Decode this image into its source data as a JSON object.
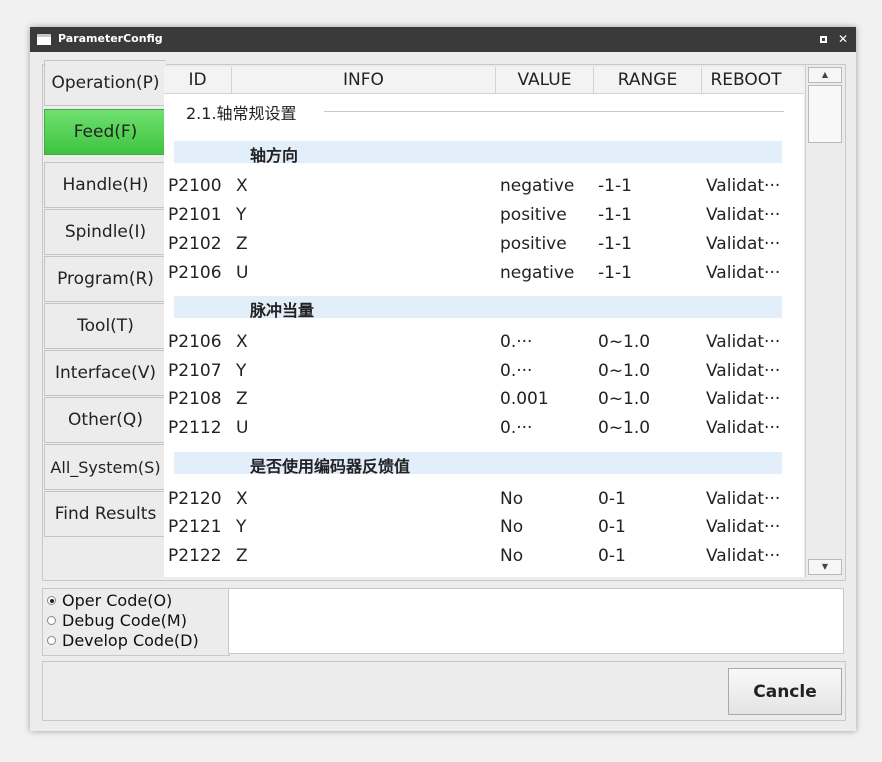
{
  "window": {
    "title": "ParameterConfig"
  },
  "sidebar": {
    "tabs": [
      {
        "label": "Operation(P)"
      },
      {
        "label": "Feed(F)",
        "active": true
      },
      {
        "label": "Handle(H)"
      },
      {
        "label": "Spindle(I)"
      },
      {
        "label": "Program(R)"
      },
      {
        "label": "Tool(T)"
      },
      {
        "label": "Interface(V)"
      },
      {
        "label": "Other(Q)"
      },
      {
        "label": "All_System(S)"
      },
      {
        "label": "Find Results"
      }
    ]
  },
  "table": {
    "headers": [
      "ID",
      "INFO",
      "VALUE",
      "RANGE",
      "REBOOT"
    ],
    "section_title": "2.1.轴常规设置",
    "groups": [
      {
        "name": "轴方向",
        "rows": [
          {
            "id": "P2100",
            "info": "X",
            "value": "negative",
            "range": "-1-1",
            "reboot": "Validat···"
          },
          {
            "id": "P2101",
            "info": "Y",
            "value": "positive",
            "range": "-1-1",
            "reboot": "Validat···"
          },
          {
            "id": "P2102",
            "info": "Z",
            "value": "positive",
            "range": "-1-1",
            "reboot": "Validat···"
          },
          {
            "id": "P2106",
            "info": "U",
            "value": "negative",
            "range": "-1-1",
            "reboot": "Validat···"
          }
        ]
      },
      {
        "name": "脉冲当量",
        "rows": [
          {
            "id": "P2106",
            "info": "X",
            "value": "0.···",
            "range": "0~1.0",
            "reboot": "Validat···"
          },
          {
            "id": "P2107",
            "info": "Y",
            "value": "0.···",
            "range": "0~1.0",
            "reboot": "Validat···"
          },
          {
            "id": "P2108",
            "info": "Z",
            "value": "0.001",
            "range": "0~1.0",
            "reboot": "Validat···"
          },
          {
            "id": "P2112",
            "info": "U",
            "value": "0.···",
            "range": "0~1.0",
            "reboot": "Validat···"
          }
        ]
      },
      {
        "name": "是否使用编码器反馈值",
        "rows": [
          {
            "id": "P2120",
            "info": "X",
            "value": "No",
            "range": "0-1",
            "reboot": "Validat···"
          },
          {
            "id": "P2121",
            "info": "Y",
            "value": "No",
            "range": "0-1",
            "reboot": "Validat···"
          },
          {
            "id": "P2122",
            "info": "Z",
            "value": "No",
            "range": "0-1",
            "reboot": "Validat···"
          }
        ]
      }
    ]
  },
  "code_mode": {
    "options": [
      {
        "label": "Oper Code(O)",
        "selected": true
      },
      {
        "label": "Debug Code(M)",
        "selected": false
      },
      {
        "label": "Develop Code(D)",
        "selected": false
      }
    ]
  },
  "footer": {
    "cancel_label": "Cancle"
  },
  "colors": {
    "active_tab": "#4fd14f",
    "group_row_bg": "#e3eefb",
    "titlebar": "#3a3a3a"
  },
  "icons": {
    "app": "window-icon",
    "maximize": "maximize-icon",
    "close": "close-icon"
  }
}
